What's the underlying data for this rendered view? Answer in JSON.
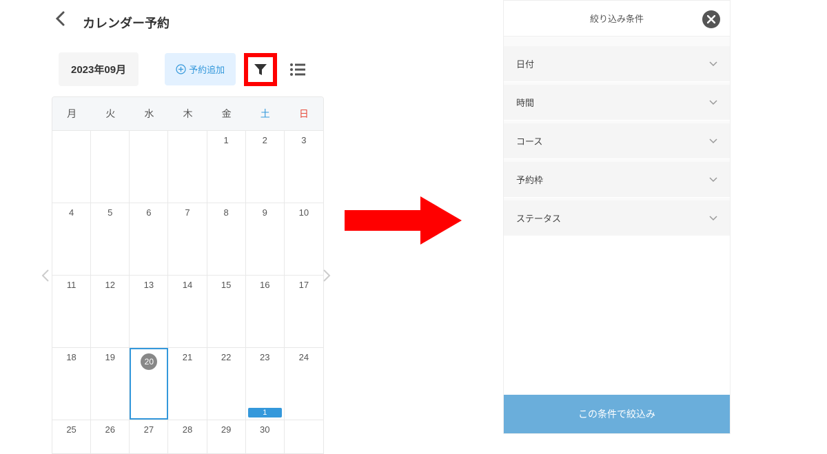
{
  "header": {
    "title": "カレンダー予約"
  },
  "toolbar": {
    "month_label": "2023年09月",
    "add_label": "予約追加"
  },
  "calendar": {
    "dow": [
      "月",
      "火",
      "水",
      "木",
      "金",
      "土",
      "日"
    ],
    "weeks": [
      [
        "",
        "",
        "",
        "",
        "1",
        "2",
        "3"
      ],
      [
        "4",
        "5",
        "6",
        "7",
        "8",
        "9",
        "10"
      ],
      [
        "11",
        "12",
        "13",
        "14",
        "15",
        "16",
        "17"
      ],
      [
        "18",
        "19",
        "20",
        "21",
        "22",
        "23",
        "24"
      ],
      [
        "25",
        "26",
        "27",
        "28",
        "29",
        "30",
        ""
      ]
    ],
    "today": "20",
    "badge_day": "23",
    "badge_value": "1"
  },
  "filter": {
    "title": "絞り込み条件",
    "items": [
      "日付",
      "時間",
      "コース",
      "予約枠",
      "ステータス"
    ],
    "apply_label": "この条件で絞込み"
  }
}
